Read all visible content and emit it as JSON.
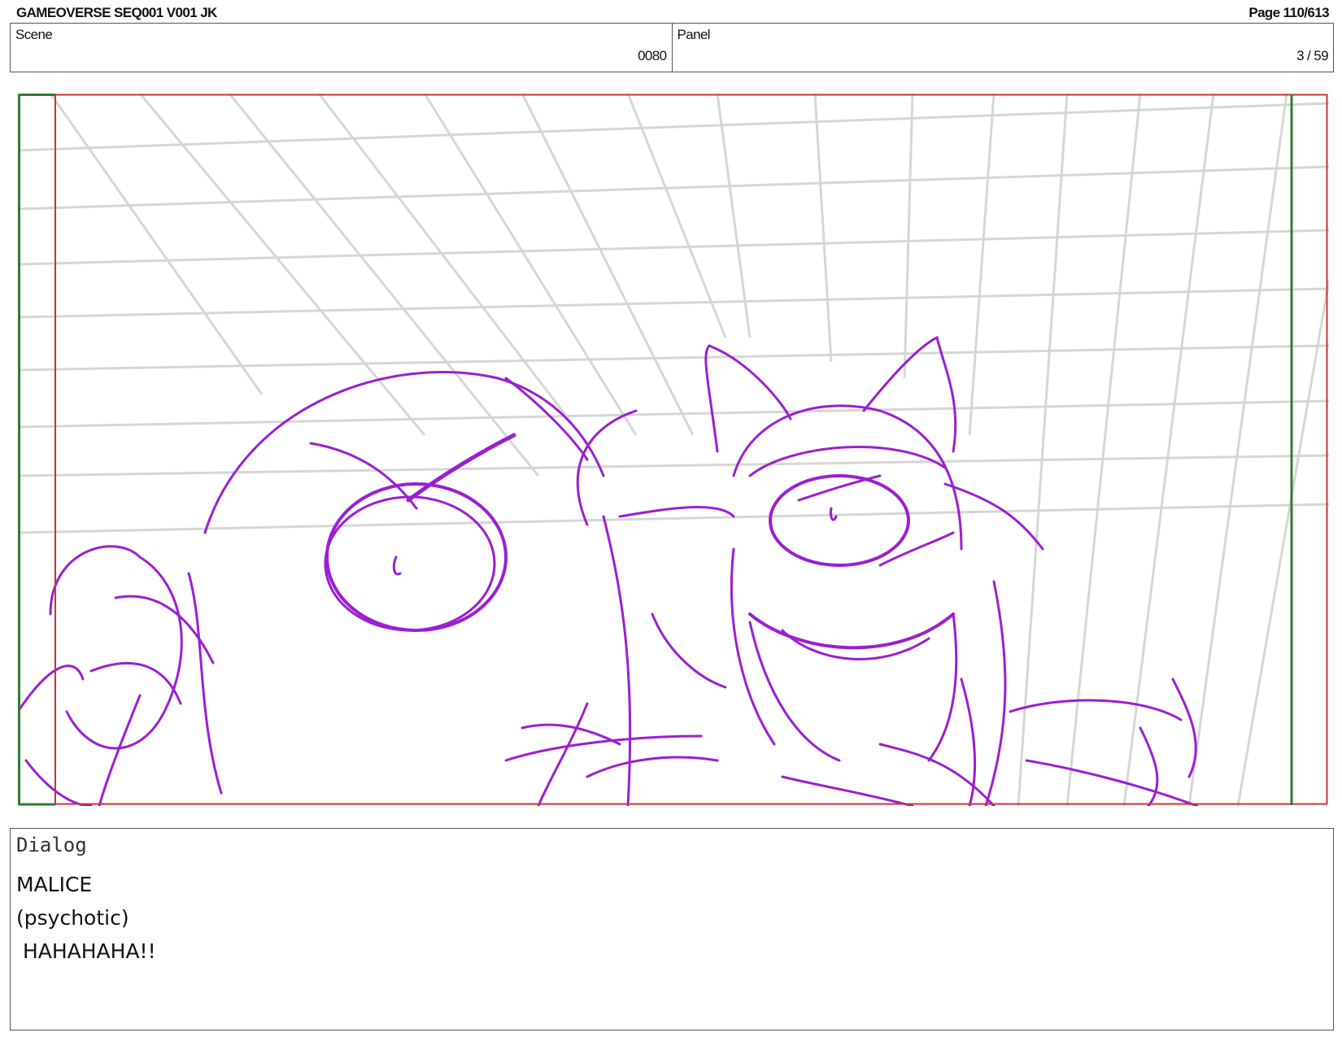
{
  "header": {
    "title": "GAMEOVERSE SEQ001 V001 JK",
    "page": "Page 110/613"
  },
  "info": {
    "scene_label": "Scene",
    "scene_value": "0080",
    "panel_label": "Panel",
    "panel_value": "3 / 59"
  },
  "frame_colors": {
    "safe_area": "#cc3333",
    "action_area": "#2e7d32",
    "sketch": "#9b1fd1",
    "grid": "#d4d4d4"
  },
  "dialog": {
    "label": "Dialog",
    "character": "MALICE",
    "parenthetical": "(psychotic)",
    "line": " HAHAHAHA!!"
  }
}
